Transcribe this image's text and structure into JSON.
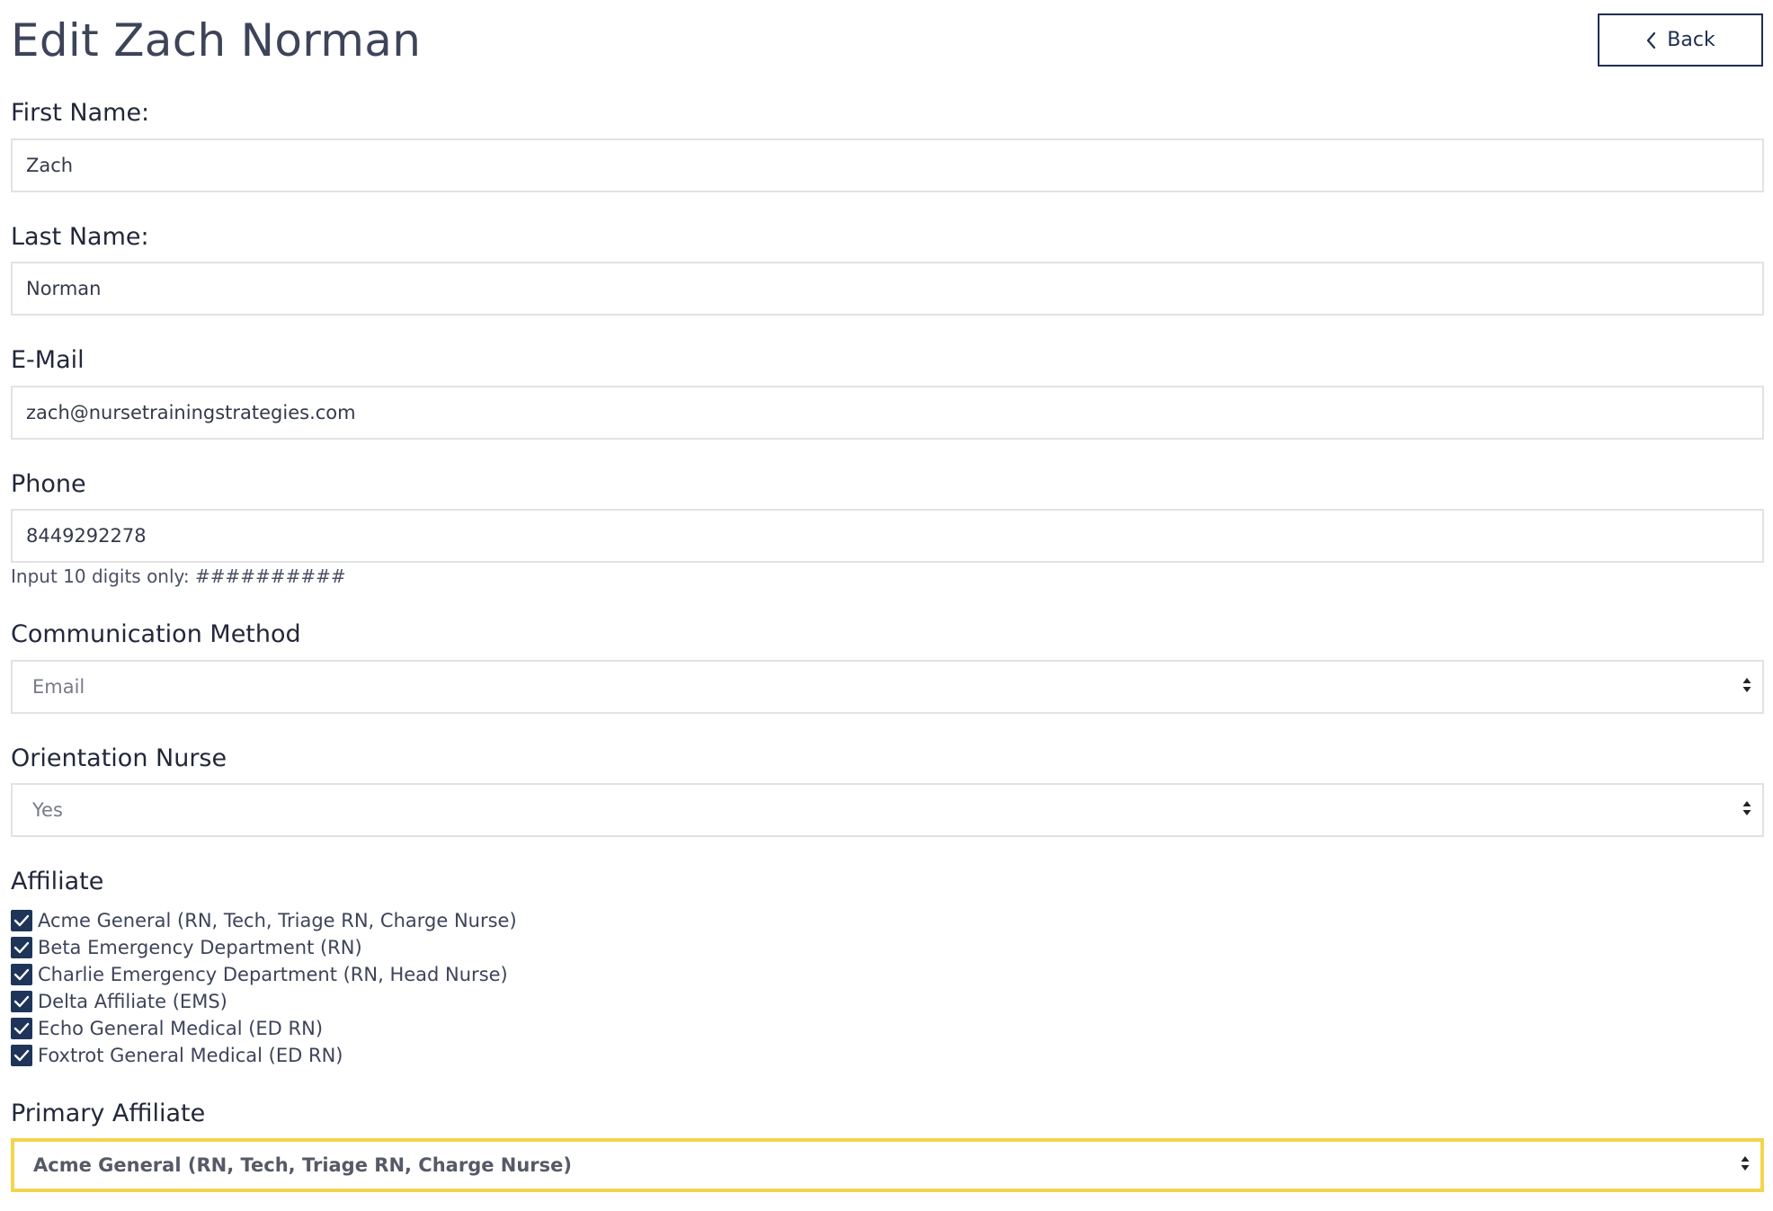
{
  "page": {
    "title": "Edit Zach Norman",
    "back_label": "Back"
  },
  "form": {
    "first_name": {
      "label": "First Name:",
      "value": "Zach"
    },
    "last_name": {
      "label": "Last Name:",
      "value": "Norman"
    },
    "email": {
      "label": "E-Mail",
      "value": "zach@nursetrainingstrategies.com"
    },
    "phone": {
      "label": "Phone",
      "value": "8449292278",
      "help": "Input 10 digits only: ##########"
    },
    "communication_method": {
      "label": "Communication Method",
      "selected": "Email"
    },
    "orientation_nurse": {
      "label": "Orientation Nurse",
      "selected": "Yes"
    },
    "affiliate": {
      "label": "Affiliate",
      "options": [
        {
          "label": "Acme General (RN, Tech, Triage RN, Charge Nurse)",
          "checked": true
        },
        {
          "label": "Beta Emergency Department (RN)",
          "checked": true
        },
        {
          "label": "Charlie Emergency Department (RN, Head Nurse)",
          "checked": true
        },
        {
          "label": "Delta Affiliate (EMS)",
          "checked": true
        },
        {
          "label": "Echo General Medical (ED RN)",
          "checked": true
        },
        {
          "label": "Foxtrot General Medical (ED RN)",
          "checked": true
        }
      ]
    },
    "primary_affiliate": {
      "label": "Primary Affiliate",
      "selected": "Acme General (RN, Tech, Triage RN, Charge Nurse)"
    }
  },
  "colors": {
    "accent_navy": "#1e3559",
    "focus_yellow": "#f2d54c",
    "text": "#3d4459"
  },
  "icons": {
    "back": "chevron-left-icon",
    "select": "sort-arrows-icon",
    "checkbox": "check-icon"
  }
}
